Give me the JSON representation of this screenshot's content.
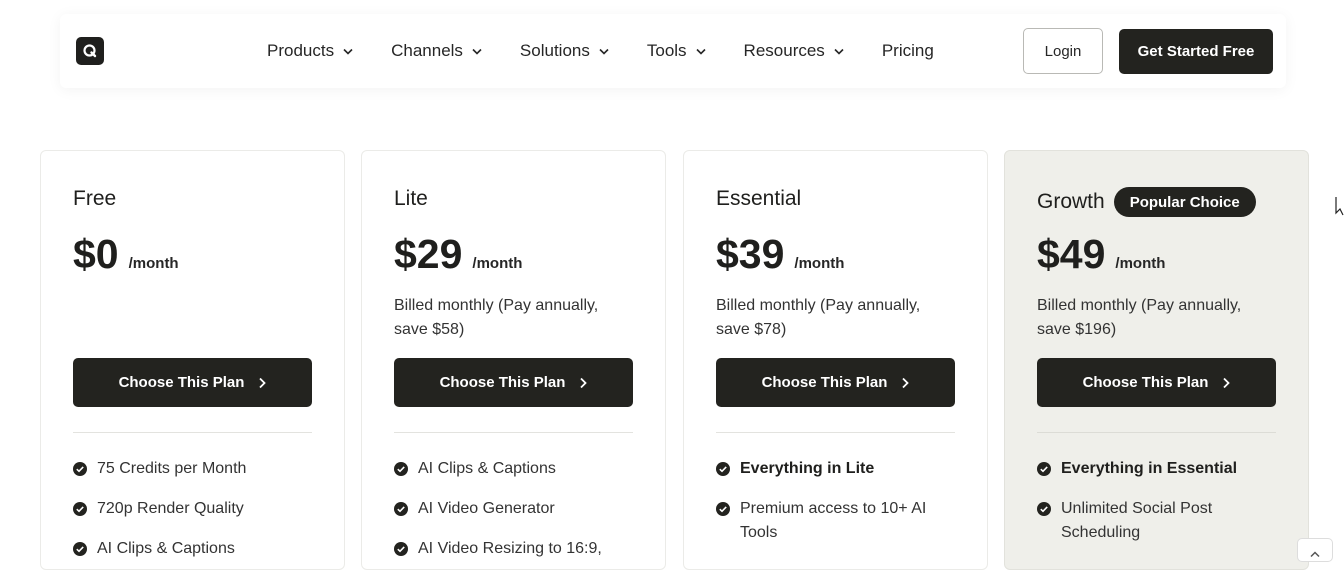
{
  "nav": {
    "items": [
      {
        "label": "Products",
        "dropdown": true
      },
      {
        "label": "Channels",
        "dropdown": true
      },
      {
        "label": "Solutions",
        "dropdown": true
      },
      {
        "label": "Tools",
        "dropdown": true
      },
      {
        "label": "Resources",
        "dropdown": true
      },
      {
        "label": "Pricing",
        "dropdown": false
      }
    ],
    "login_label": "Login",
    "start_label": "Get Started Free"
  },
  "plans": [
    {
      "name": "Free",
      "price": "$0",
      "per": "/month",
      "billed": "",
      "cta": "Choose This Plan",
      "features": [
        {
          "text": "75 Credits per Month",
          "bold": false
        },
        {
          "text": "720p Render Quality",
          "bold": false
        },
        {
          "text": "AI Clips & Captions",
          "bold": false
        }
      ]
    },
    {
      "name": "Lite",
      "price": "$29",
      "per": "/month",
      "billed": "Billed monthly (Pay annually, save $58)",
      "cta": "Choose This Plan",
      "features": [
        {
          "text": "AI Clips & Captions",
          "bold": false
        },
        {
          "text": "AI Video Generator",
          "bold": false
        },
        {
          "text": "AI Video Resizing to 16:9,",
          "bold": false
        }
      ]
    },
    {
      "name": "Essential",
      "price": "$39",
      "per": "/month",
      "billed": "Billed monthly (Pay annually, save $78)",
      "cta": "Choose This Plan",
      "features": [
        {
          "text": "Everything in Lite",
          "bold": true
        },
        {
          "text": "Premium access to 10+ AI Tools",
          "bold": false
        }
      ]
    },
    {
      "name": "Growth",
      "price": "$49",
      "per": "/month",
      "badge": "Popular Choice",
      "billed": "Billed monthly (Pay annually, save $196)",
      "cta": "Choose This Plan",
      "features": [
        {
          "text": "Everything in Essential",
          "bold": true
        },
        {
          "text": "Unlimited Social Post Scheduling",
          "bold": false
        }
      ]
    }
  ],
  "colors": {
    "primary": "#23231f",
    "featured_bg": "#efefea",
    "border": "#ebebe8"
  },
  "icons": {
    "logo": "logo-icon",
    "dropdown": "chevron-down-icon",
    "cta_arrow": "chevron-right-icon",
    "feature": "check-circle-icon",
    "scroll": "chevron-up-icon"
  }
}
